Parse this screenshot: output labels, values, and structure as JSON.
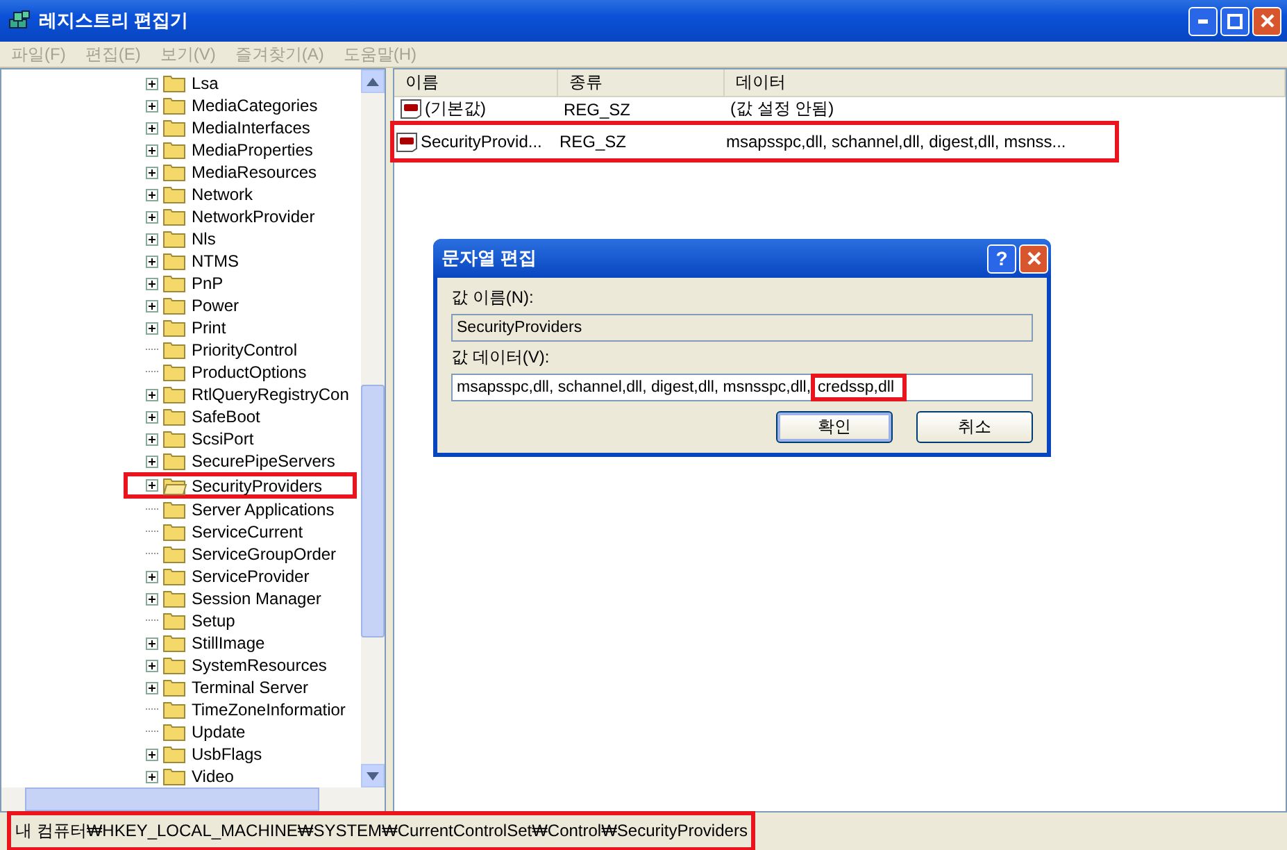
{
  "window": {
    "title": "레지스트리 편집기"
  },
  "menu": [
    {
      "label": "파일(F)"
    },
    {
      "label": "편집(E)"
    },
    {
      "label": "보기(V)"
    },
    {
      "label": "즐겨찾기(A)"
    },
    {
      "label": "도움말(H)"
    }
  ],
  "tree": [
    {
      "label": "Lsa",
      "expander": true,
      "selected": false,
      "highlighted": false
    },
    {
      "label": "MediaCategories",
      "expander": true,
      "selected": false,
      "highlighted": false
    },
    {
      "label": "MediaInterfaces",
      "expander": true,
      "selected": false,
      "highlighted": false
    },
    {
      "label": "MediaProperties",
      "expander": true,
      "selected": false,
      "highlighted": false
    },
    {
      "label": "MediaResources",
      "expander": true,
      "selected": false,
      "highlighted": false
    },
    {
      "label": "Network",
      "expander": true,
      "selected": false,
      "highlighted": false
    },
    {
      "label": "NetworkProvider",
      "expander": true,
      "selected": false,
      "highlighted": false
    },
    {
      "label": "Nls",
      "expander": true,
      "selected": false,
      "highlighted": false
    },
    {
      "label": "NTMS",
      "expander": true,
      "selected": false,
      "highlighted": false
    },
    {
      "label": "PnP",
      "expander": true,
      "selected": false,
      "highlighted": false
    },
    {
      "label": "Power",
      "expander": true,
      "selected": false,
      "highlighted": false
    },
    {
      "label": "Print",
      "expander": true,
      "selected": false,
      "highlighted": false
    },
    {
      "label": "PriorityControl",
      "expander": false,
      "selected": false,
      "highlighted": false
    },
    {
      "label": "ProductOptions",
      "expander": false,
      "selected": false,
      "highlighted": false
    },
    {
      "label": "RtlQueryRegistryCon",
      "expander": true,
      "selected": false,
      "highlighted": false
    },
    {
      "label": "SafeBoot",
      "expander": true,
      "selected": false,
      "highlighted": false
    },
    {
      "label": "ScsiPort",
      "expander": true,
      "selected": false,
      "highlighted": false
    },
    {
      "label": "SecurePipeServers",
      "expander": true,
      "selected": false,
      "highlighted": false
    },
    {
      "label": "SecurityProviders",
      "expander": true,
      "selected": true,
      "highlighted": true
    },
    {
      "label": "Server Applications",
      "expander": false,
      "selected": false,
      "highlighted": false
    },
    {
      "label": "ServiceCurrent",
      "expander": false,
      "selected": false,
      "highlighted": false
    },
    {
      "label": "ServiceGroupOrder",
      "expander": false,
      "selected": false,
      "highlighted": false
    },
    {
      "label": "ServiceProvider",
      "expander": true,
      "selected": false,
      "highlighted": false
    },
    {
      "label": "Session Manager",
      "expander": true,
      "selected": false,
      "highlighted": false
    },
    {
      "label": "Setup",
      "expander": false,
      "selected": false,
      "highlighted": false
    },
    {
      "label": "StillImage",
      "expander": true,
      "selected": false,
      "highlighted": false
    },
    {
      "label": "SystemResources",
      "expander": true,
      "selected": false,
      "highlighted": false
    },
    {
      "label": "Terminal Server",
      "expander": true,
      "selected": false,
      "highlighted": false
    },
    {
      "label": "TimeZoneInformatior",
      "expander": false,
      "selected": false,
      "highlighted": false
    },
    {
      "label": "Update",
      "expander": false,
      "selected": false,
      "highlighted": false
    },
    {
      "label": "UsbFlags",
      "expander": true,
      "selected": false,
      "highlighted": false
    },
    {
      "label": "Video",
      "expander": true,
      "selected": false,
      "highlighted": false
    }
  ],
  "table": {
    "columns": [
      "이름",
      "종류",
      "데이터"
    ],
    "rows": [
      {
        "name": "(기본값)",
        "type": "REG_SZ",
        "data": "(값 설정 안됨)",
        "highlighted": false
      },
      {
        "name": "SecurityProvid...",
        "type": "REG_SZ",
        "data": "msapsspc,dll, schannel,dll, digest,dll, msnss...",
        "highlighted": true
      }
    ]
  },
  "dialog": {
    "title": "문자열 편집",
    "help": "?",
    "name_label": "값 이름(N):",
    "name_value": "SecurityProviders",
    "data_label": "값 데이터(V):",
    "data_value": [
      {
        "text": "msapsspc,dll, schannel,dll, digest,dll, msnsspc,dll,",
        "highlighted": false
      },
      {
        "text": "credssp,dll",
        "highlighted": true
      }
    ],
    "buttons": [
      "확인",
      "취소"
    ]
  },
  "status_bar": {
    "text": "내 컴퓨터₩HKEY_LOCAL_MACHINE₩SYSTEM₩CurrentControlSet₩Control₩SecurityProviders",
    "highlighted": true
  }
}
